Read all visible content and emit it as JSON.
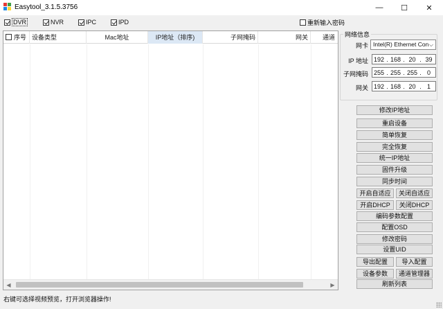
{
  "window": {
    "title": "Easytool_3.1.5.3756",
    "controls": {
      "minimize": "—",
      "maximize": "☐",
      "close": "✕"
    }
  },
  "filters": [
    {
      "label": "DVR",
      "checked": true
    },
    {
      "label": "NVR",
      "checked": true
    },
    {
      "label": "IPC",
      "checked": true
    },
    {
      "label": "IPD",
      "checked": true
    }
  ],
  "reenter_password": {
    "label": "重新输入密码",
    "checked": false
  },
  "table": {
    "columns": [
      "序号",
      "设备类型",
      "Mac地址",
      "IP地址（排序)",
      "子网掩码",
      "网关",
      "通道"
    ],
    "sorted_column": "IP地址（排序)",
    "rows": [],
    "scroll": {
      "left_arrow": "◀",
      "right_arrow": "▶"
    }
  },
  "network": {
    "group_title": "网络信息",
    "nic_label": "网卡",
    "nic_value": "Intel(R) Ethernet Con",
    "ip_label": "IP 地址",
    "ip": [
      "192",
      "168",
      "20",
      "39"
    ],
    "mask_label": "子网掩码",
    "mask": [
      "255",
      "255",
      "255",
      "0"
    ],
    "gateway_label": "网关",
    "gateway": [
      "192",
      "168",
      "20",
      "1"
    ]
  },
  "actions": {
    "modify_ip": "修改IP地址",
    "restart": "重启设备",
    "simple_restore": "简单恢复",
    "full_restore": "完全恢复",
    "unified_ip": "统一IP地址",
    "firmware_upgrade": "固件升级",
    "sync_time": "同步时间",
    "enable_adaptive": "开启自适应",
    "disable_adaptive": "关闭自适应",
    "enable_dhcp": "开启DHCP",
    "disable_dhcp": "关闭DHCP",
    "encoding_params": "编码参数配置",
    "osd_config": "配置OSD",
    "change_password": "修改密码",
    "set_uid": "设置UID",
    "export_config": "导出配置",
    "import_config": "导入配置",
    "device_params": "设备参数",
    "channel_manager": "通道管理器",
    "refresh_list": "刷新列表"
  },
  "status_text": "右键可选择视频预览，打开浏览器操作!",
  "colors": {
    "window_bg": "#f0f0f0",
    "sorted_header_bg": "#dce8f5",
    "button_bg": "#e1e1e1"
  }
}
